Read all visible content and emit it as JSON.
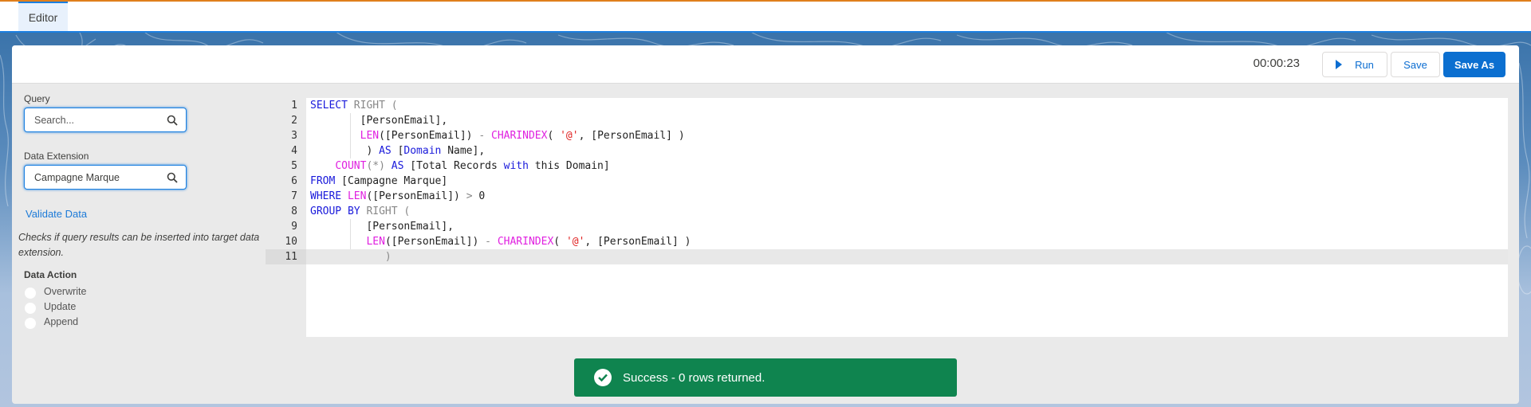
{
  "tabs": [
    {
      "label": "Editor",
      "active": true
    }
  ],
  "toolbar": {
    "timer": "00:00:23",
    "run_label": "Run",
    "save_label": "Save",
    "save_as_label": "Save As"
  },
  "sidebar": {
    "query_label": "Query",
    "query_placeholder": "Search...",
    "data_extension_label": "Data Extension",
    "data_extension_value": "Campagne Marque",
    "validate_link": "Validate Data",
    "help_text": "Checks if query results can be inserted into target data extension.",
    "data_action_label": "Data Action",
    "data_actions": [
      {
        "label": "Overwrite",
        "selected": false
      },
      {
        "label": "Update",
        "selected": false
      },
      {
        "label": "Append",
        "selected": false
      }
    ]
  },
  "editor": {
    "line_numbers": [
      "1",
      "2",
      "3",
      "4",
      "5",
      "6",
      "7",
      "8",
      "9",
      "10",
      "11"
    ],
    "lines": [
      [
        {
          "t": "SELECT",
          "c": "kw"
        },
        {
          "t": " "
        },
        {
          "t": "RIGHT (",
          "c": "gr"
        }
      ],
      [
        {
          "t": "        [PersonEmail],"
        }
      ],
      [
        {
          "t": "        "
        },
        {
          "t": "LEN",
          "c": "fn"
        },
        {
          "t": "([PersonEmail]) "
        },
        {
          "t": "-",
          "c": "gr"
        },
        {
          "t": " "
        },
        {
          "t": "CHARINDEX",
          "c": "fn"
        },
        {
          "t": "( "
        },
        {
          "t": "'@'",
          "c": "str"
        },
        {
          "t": ", [PersonEmail] )"
        }
      ],
      [
        {
          "t": "         ) "
        },
        {
          "t": "AS",
          "c": "kw"
        },
        {
          "t": " ["
        },
        {
          "t": "Domain",
          "c": "kw"
        },
        {
          "t": " Name],"
        }
      ],
      [
        {
          "t": "    "
        },
        {
          "t": "COUNT",
          "c": "fn"
        },
        {
          "t": "(*) ",
          "c": "gr"
        },
        {
          "t": "AS",
          "c": "kw"
        },
        {
          "t": " [Total Records "
        },
        {
          "t": "with",
          "c": "kw"
        },
        {
          "t": " this Domain]"
        }
      ],
      [
        {
          "t": "FROM",
          "c": "kw"
        },
        {
          "t": " [Campagne Marque]"
        }
      ],
      [
        {
          "t": "WHERE",
          "c": "kw"
        },
        {
          "t": " "
        },
        {
          "t": "LEN",
          "c": "fn"
        },
        {
          "t": "([PersonEmail]) "
        },
        {
          "t": ">",
          "c": "gr"
        },
        {
          "t": " 0"
        }
      ],
      [
        {
          "t": "GROUP BY",
          "c": "kw"
        },
        {
          "t": " "
        },
        {
          "t": "RIGHT (",
          "c": "gr"
        }
      ],
      [
        {
          "t": "         [PersonEmail],"
        }
      ],
      [
        {
          "t": "         "
        },
        {
          "t": "LEN",
          "c": "fn"
        },
        {
          "t": "([PersonEmail]) "
        },
        {
          "t": "-",
          "c": "gr"
        },
        {
          "t": " "
        },
        {
          "t": "CHARINDEX",
          "c": "fn"
        },
        {
          "t": "( "
        },
        {
          "t": "'@'",
          "c": "str"
        },
        {
          "t": ", [PersonEmail] )"
        }
      ],
      [
        {
          "t": "            )",
          "c": "gr"
        }
      ]
    ],
    "active_line": 11
  },
  "toast": {
    "message": "Success - 0 rows returned.",
    "status": "success",
    "color": "#0f844f"
  },
  "colors": {
    "accent": "#0b6fd0",
    "top_bar": "#e07f1c"
  }
}
